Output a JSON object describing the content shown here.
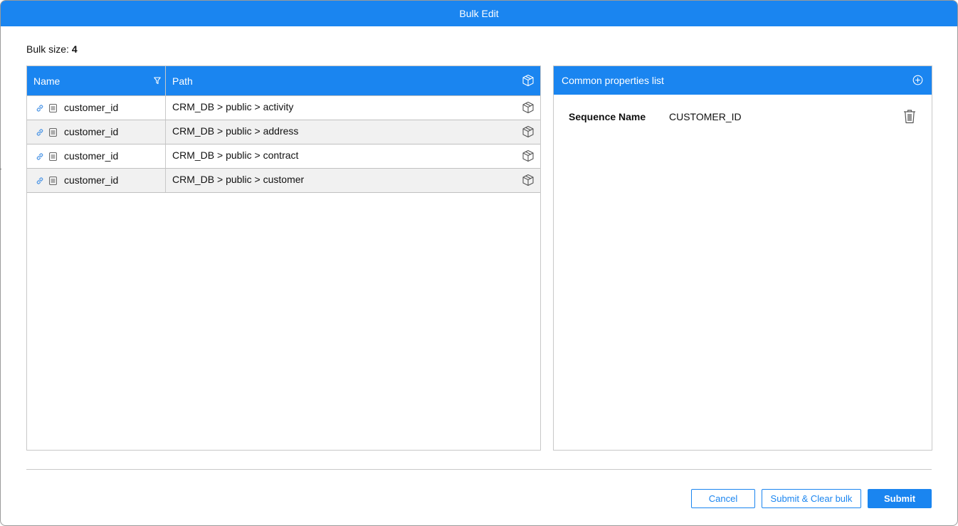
{
  "dialog": {
    "title": "Bulk Edit"
  },
  "bulk": {
    "label": "Bulk size: ",
    "size": "4"
  },
  "table": {
    "columns": {
      "name": "Name",
      "path": "Path"
    },
    "rows": [
      {
        "name": "customer_id",
        "path": "CRM_DB > public > activity"
      },
      {
        "name": "customer_id",
        "path": "CRM_DB > public > address"
      },
      {
        "name": "customer_id",
        "path": "CRM_DB > public > contract"
      },
      {
        "name": "customer_id",
        "path": "CRM_DB > public > customer"
      }
    ]
  },
  "properties": {
    "header": "Common properties list",
    "items": [
      {
        "name": "Sequence Name",
        "value": "CUSTOMER_ID"
      }
    ]
  },
  "buttons": {
    "cancel": "Cancel",
    "submit_clear": "Submit & Clear bulk",
    "submit": "Submit"
  },
  "colors": {
    "accent": "#1a85f0",
    "row_alt": "#f1f1f1",
    "border": "#c8c8c8"
  },
  "icons": {
    "filter": "filter-icon",
    "cube": "cube-icon",
    "link": "link-icon",
    "table": "table-icon",
    "add": "add-circle-icon",
    "trash": "trash-icon"
  }
}
